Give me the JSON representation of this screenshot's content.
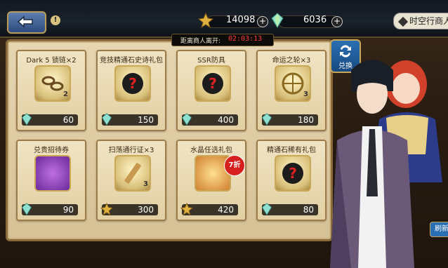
{
  "topbar": {
    "gold": "14098",
    "gems": "6036",
    "merchant_label": "时空行商人"
  },
  "timer": {
    "label": "距离商人离开:",
    "value": "02:03:13"
  },
  "exchange_label": "兑换",
  "refresh_label": "刷新",
  "cards": [
    {
      "name": "Dark 5 锁链×2",
      "qty": "2",
      "price": "60",
      "currency": "gem-icon",
      "icon": "chain-icon"
    },
    {
      "name": "竞技精通石史诗礼包",
      "qty": "",
      "price": "150",
      "currency": "gem-icon",
      "icon": "mystery-pack-icon"
    },
    {
      "name": "SSR防具",
      "qty": "",
      "price": "400",
      "currency": "gem-icon",
      "icon": "armor-icon"
    },
    {
      "name": "命运之轮×3",
      "qty": "3",
      "price": "180",
      "currency": "gem-icon",
      "icon": "wheel-icon"
    },
    {
      "name": "兑贵招待券",
      "qty": "",
      "price": "90",
      "currency": "gem-icon",
      "icon": "ticket-icon"
    },
    {
      "name": "扫荡通行证×3",
      "qty": "3",
      "price": "300",
      "currency": "gold-icon",
      "icon": "pass-icon"
    },
    {
      "name": "水晶任选礼包",
      "qty": "",
      "price": "420",
      "currency": "gold-icon",
      "icon": "crystal-pack-icon",
      "badge": "7折"
    },
    {
      "name": "精通石稀有礼包",
      "qty": "",
      "price": "80",
      "currency": "gem-icon",
      "icon": "mystery-pack-icon"
    }
  ]
}
